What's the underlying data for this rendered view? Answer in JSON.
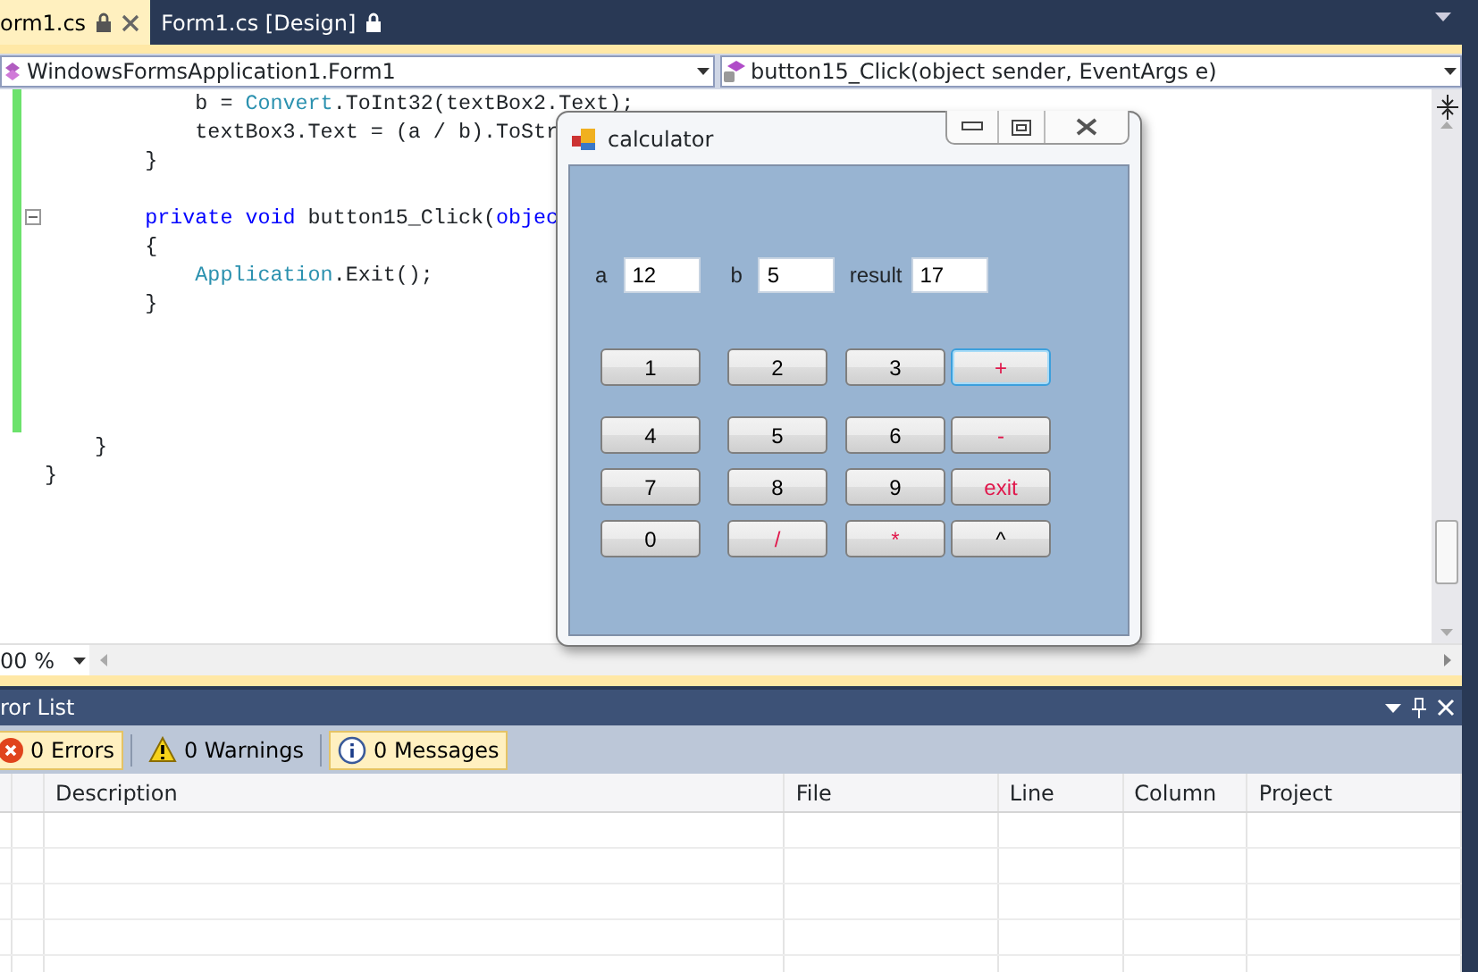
{
  "tabs": [
    {
      "label": "orm1.cs",
      "selected": true,
      "locked": true,
      "closable": true
    },
    {
      "label": "Form1.cs [Design]",
      "selected": false,
      "locked": true,
      "closable": false
    }
  ],
  "navigation": {
    "type_combo": "WindowsFormsApplication1.Form1",
    "member_combo": "button15_Click(object sender, EventArgs e)"
  },
  "code_lines": [
    {
      "kind": "code",
      "changed": true,
      "segments": [
        {
          "text": "            b = ",
          "kind": "plain"
        },
        {
          "text": "Convert",
          "kind": "type"
        },
        {
          "text": ".ToInt32(textBox2.Text);",
          "kind": "plain"
        }
      ]
    },
    {
      "kind": "code",
      "changed": true,
      "segments": [
        {
          "text": "            textBox3.Text = (a / b).ToStr",
          "kind": "plain"
        }
      ]
    },
    {
      "kind": "code",
      "changed": true,
      "segments": [
        {
          "text": "        }",
          "kind": "plain"
        }
      ]
    },
    {
      "kind": "blank",
      "changed": true
    },
    {
      "kind": "code",
      "changed": true,
      "collapsible": true,
      "segments": [
        {
          "text": "        private void",
          "kind": "keyword"
        },
        {
          "text": " button15_Click(",
          "kind": "plain"
        },
        {
          "text": "objec",
          "kind": "keyword"
        }
      ]
    },
    {
      "kind": "code",
      "changed": true,
      "segments": [
        {
          "text": "        {",
          "kind": "plain"
        }
      ]
    },
    {
      "kind": "code",
      "changed": true,
      "segments": [
        {
          "text": "            Application",
          "kind": "type"
        },
        {
          "text": ".Exit();",
          "kind": "plain"
        }
      ]
    },
    {
      "kind": "code",
      "changed": true,
      "segments": [
        {
          "text": "        }",
          "kind": "plain"
        }
      ]
    },
    {
      "kind": "blank",
      "changed": true
    },
    {
      "kind": "blank",
      "changed": true
    },
    {
      "kind": "blank",
      "changed": true
    },
    {
      "kind": "blank",
      "changed": true
    },
    {
      "kind": "code",
      "changed": false,
      "segments": [
        {
          "text": "    }",
          "kind": "plain"
        }
      ]
    },
    {
      "kind": "code",
      "changed": false,
      "segments": [
        {
          "text": "}",
          "kind": "plain"
        }
      ]
    }
  ],
  "zoom": "00 %",
  "calculator": {
    "title": "calculator",
    "fields": [
      {
        "label": "a",
        "value": "12"
      },
      {
        "label": "b",
        "value": "5"
      },
      {
        "label": "result",
        "value": "17"
      }
    ],
    "button_rows": [
      [
        {
          "label": "1",
          "color": "#000000",
          "focused": false
        },
        {
          "label": "2",
          "color": "#000000",
          "focused": false
        },
        {
          "label": "3",
          "color": "#000000",
          "focused": false
        },
        {
          "label": "+",
          "color": "#e0184c",
          "focused": true
        }
      ],
      [
        {
          "label": "4",
          "color": "#000000",
          "focused": false
        },
        {
          "label": "5",
          "color": "#000000",
          "focused": false
        },
        {
          "label": "6",
          "color": "#000000",
          "focused": false
        },
        {
          "label": "-",
          "color": "#e0184c",
          "focused": false
        }
      ],
      [
        {
          "label": "7",
          "color": "#000000",
          "focused": false
        },
        {
          "label": "8",
          "color": "#000000",
          "focused": false
        },
        {
          "label": "9",
          "color": "#000000",
          "focused": false
        },
        {
          "label": "exit",
          "color": "#e0184c",
          "focused": false
        }
      ],
      [
        {
          "label": "0",
          "color": "#000000",
          "focused": false
        },
        {
          "label": "/",
          "color": "#e0184c",
          "focused": false
        },
        {
          "label": "*",
          "color": "#e0184c",
          "focused": false
        },
        {
          "label": "^",
          "color": "#000000",
          "focused": false
        }
      ]
    ]
  },
  "error_list": {
    "title": "ror List",
    "filters": [
      {
        "kind": "error",
        "label": "0 Errors",
        "selected": true
      },
      {
        "kind": "warning",
        "label": "0 Warnings",
        "selected": false
      },
      {
        "kind": "message",
        "label": "0 Messages",
        "selected": true
      }
    ],
    "columns": [
      "Description",
      "File",
      "Line",
      "Column",
      "Project"
    ]
  }
}
